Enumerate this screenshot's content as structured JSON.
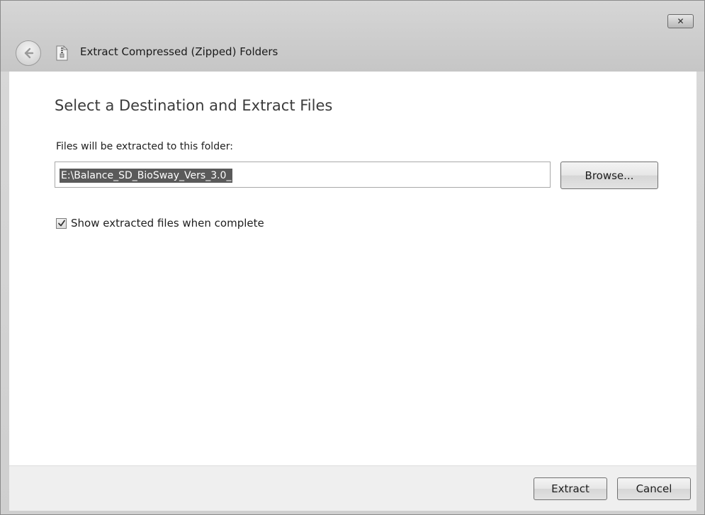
{
  "window": {
    "title": "Extract Compressed (Zipped) Folders",
    "close_label": "✕"
  },
  "icons": {
    "back": "back-arrow-icon",
    "app": "zip-folder-icon",
    "close": "close-icon",
    "checkmark": "checkmark-icon"
  },
  "main": {
    "heading": "Select a Destination and Extract Files",
    "path_label": "Files will be extracted to this folder:",
    "path_value": "E:\\Balance_SD_BioSway_Vers_3.0_",
    "browse_label": "Browse...",
    "show_files_label": "Show extracted files when complete",
    "show_files_checked": true
  },
  "footer": {
    "extract_label": "Extract",
    "cancel_label": "Cancel"
  }
}
